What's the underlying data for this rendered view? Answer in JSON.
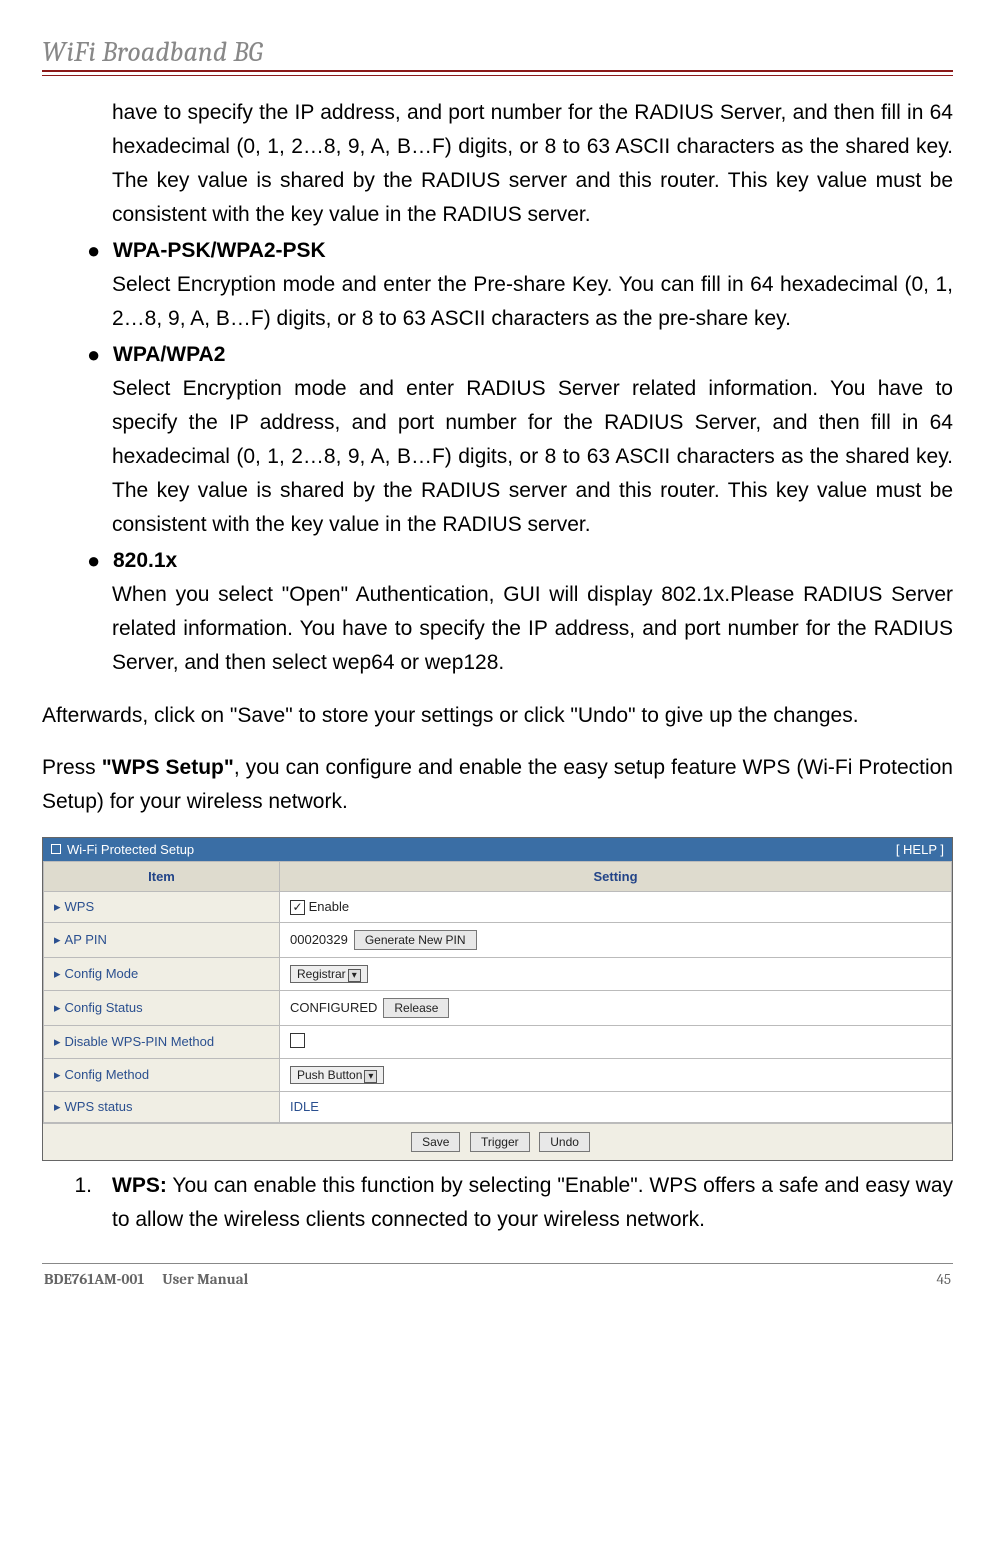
{
  "header": {
    "title": "WiFi Broadband BG"
  },
  "sections": {
    "lead_in": "have to specify the IP address, and port number for the RADIUS Server, and then fill in 64 hexadecimal (0, 1, 2…8, 9, A, B…F) digits, or 8 to 63 ASCII characters as the shared key. The key value is shared by the RADIUS server and this router. This key value must be consistent with the key value in the RADIUS server.",
    "b1_head": "WPA-PSK/WPA2-PSK",
    "b1_body": "Select Encryption mode and enter the Pre-share Key. You can fill in 64 hexadecimal (0, 1, 2…8, 9, A, B…F) digits, or 8 to 63 ASCII characters as the pre-share key.",
    "b2_head": "WPA/WPA2",
    "b2_body": "Select Encryption mode and enter RADIUS Server related information. You have to specify the IP address, and port number for the RADIUS Server, and then fill in 64 hexadecimal (0, 1, 2…8, 9, A, B…F) digits, or 8 to 63 ASCII characters as the shared key. The key value is shared by the RADIUS server and this router. This key value must be consistent with the key value in the RADIUS server.",
    "b3_head": "820.1x",
    "b3_body": "When you select \"Open\" Authentication, GUI will display 802.1x.Please RADIUS Server related information. You have to specify the IP address, and port number for the RADIUS Server, and then select wep64 or wep128.",
    "after_save": "Afterwards, click on \"Save\" to store your settings or click \"Undo\" to give up the changes.",
    "press_prefix": "Press ",
    "press_bold": "\"WPS Setup\"",
    "press_suffix": ", you can configure and enable the easy setup feature WPS (Wi-Fi Protection Setup) for your wireless network."
  },
  "shot": {
    "title": "Wi-Fi Protected Setup",
    "help": "[ HELP ]",
    "col_item": "Item",
    "col_setting": "Setting",
    "rows": {
      "wps": "WPS",
      "wps_enable": "Enable",
      "ap_pin": "AP PIN",
      "ap_pin_val": "00020329",
      "gen_pin": "Generate New PIN",
      "config_mode": "Config Mode",
      "config_mode_val": "Registrar",
      "config_status": "Config Status",
      "config_status_val": "CONFIGURED",
      "release": "Release",
      "disable_wps_pin": "Disable WPS-PIN Method",
      "config_method": "Config Method",
      "config_method_val": "Push Button",
      "wps_status": "WPS status",
      "wps_status_val": "IDLE"
    },
    "btn_save": "Save",
    "btn_trigger": "Trigger",
    "btn_undo": "Undo"
  },
  "ol1_num": "1.",
  "ol1_bold": "WPS:",
  "ol1_text": " You can enable this function by selecting \"Enable\". WPS offers a safe and easy way to allow the wireless clients connected to your wireless network.",
  "footer": {
    "code": "BDE761AM-001",
    "label": "User Manual",
    "page": "45"
  }
}
